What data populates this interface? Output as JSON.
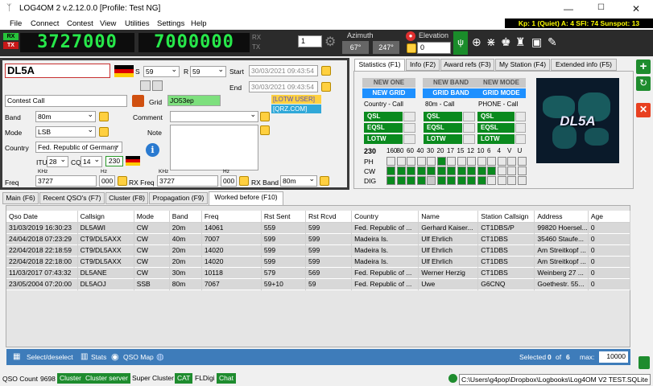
{
  "app": {
    "title": "LOG4OM 2 v.2.12.0.0 [Profile: Test NG]"
  },
  "menu": [
    "File",
    "Connect",
    "Contest",
    "View",
    "Utilities",
    "Settings",
    "Help"
  ],
  "solar": {
    "text": "Kp: 1 (Quiet)  A: 4  SFI: 74  Sunspot: 13"
  },
  "radio": {
    "rx": "RX",
    "tx": "TX",
    "freq1": "3727000",
    "freq2": "7000000",
    "rx_label": "RX",
    "tx_label": "TX",
    "vfo": "1",
    "azimuth_label": "Azimuth",
    "az1": "67°",
    "az2": "247°",
    "elevation_label": "Elevation",
    "elevation": "0"
  },
  "qso": {
    "callsign": "DL5A",
    "s_label": "S",
    "s": "59",
    "r_label": "R",
    "r": "59",
    "start_label": "Start",
    "start": "30/03/2021 09:43:54",
    "end_label": "End",
    "end": "30/03/2021 09:43:54",
    "contest_placeholder": "Contest Call",
    "grid_label": "Grid",
    "grid": "JO53ep",
    "band_label": "Band",
    "band": "80m",
    "comment_label": "Comment",
    "mode_label": "Mode",
    "mode": "LSB",
    "note_label": "Note",
    "country_label": "Country",
    "country": "Fed. Republic of Germany",
    "itu_label": "ITU",
    "itu": "28",
    "cq_label": "CQ",
    "cq": "14",
    "dxcc": "230",
    "freq_label": "Freq",
    "khz_label": "KHz",
    "hz_label": "Hz",
    "freq_khz": "3727",
    "freq_hz": "000",
    "rxfreq_label": "RX Freq",
    "rxfreq_khz": "3727",
    "rxfreq_hz": "000",
    "rxband_label": "RX Band",
    "rxband": "80m",
    "lotw": "[LOTW USER]",
    "qrz": "[QRZ.COM]"
  },
  "stats": {
    "tabs": [
      "Statistics (F1)",
      "Info (F2)",
      "Award refs (F3)",
      "My Station (F4)",
      "Extended info (F5)"
    ],
    "cols": [
      {
        "top": "NEW ONE",
        "bot": "NEW GRID",
        "sub": "Country - Call"
      },
      {
        "top": "NEW BAND",
        "bot": "GRID BAND",
        "sub": "80m - Call"
      },
      {
        "top": "NEW MODE",
        "bot": "GRID MODE",
        "sub": "PHONE - Call"
      }
    ],
    "conf": [
      "QSL",
      "EQSL",
      "LOTW"
    ],
    "dxcc": "230",
    "bands": [
      "160",
      "80",
      "60",
      "40",
      "30",
      "20",
      "17",
      "15",
      "12",
      "10",
      "6",
      "4",
      "V",
      "U"
    ],
    "rows": [
      "PH",
      "CW",
      "DIG"
    ],
    "call_image": "DL5A"
  },
  "tabs": [
    "Main (F6)",
    "Recent QSO's (F7)",
    "Cluster (F8)",
    "Propagation (F9)",
    "Worked before (F10)"
  ],
  "table": {
    "headers": [
      "Qso Date",
      "Callsign",
      "Mode",
      "Band",
      "Freq",
      "Rst Sent",
      "Rst Rcvd",
      "Country",
      "Name",
      "Station Callsign",
      "Address",
      "Age"
    ],
    "rows": [
      [
        "31/03/2019 16:30:23",
        "DL5AWI",
        "CW",
        "20m",
        "14061",
        "559",
        "599",
        "Fed. Republic of ...",
        "Gerhard Kaiser...",
        "CT1DBS/P",
        "99820 Hoersel...",
        "0"
      ],
      [
        "24/04/2018 07:23:29",
        "CT9/DL5AXX",
        "CW",
        "40m",
        "7007",
        "599",
        "599",
        "Madeira Is.",
        "Ulf Ehrlich",
        "CT1DBS",
        "35460 Staufe...",
        "0"
      ],
      [
        "22/04/2018 22:18:59",
        "CT9/DL5AXX",
        "CW",
        "20m",
        "14020",
        "599",
        "599",
        "Madeira Is.",
        "Ulf Ehrlich",
        "CT1DBS",
        "Am Streitkopf ...",
        "0"
      ],
      [
        "22/04/2018 22:18:00",
        "CT9/DL5AXX",
        "CW",
        "20m",
        "14020",
        "599",
        "599",
        "Madeira Is.",
        "Ulf Ehrlich",
        "CT1DBS",
        "Am Streitkopf ...",
        "0"
      ],
      [
        "11/03/2017 07:43:32",
        "DL5ANE",
        "CW",
        "30m",
        "10118",
        "579",
        "569",
        "Fed. Republic of ...",
        "Werner Herzig",
        "CT1DBS",
        "Weinberg 27 ...",
        "0"
      ],
      [
        "23/05/2004 07:20:00",
        "DL5AOJ",
        "SSB",
        "80m",
        "7067",
        "59+10",
        "59",
        "Fed. Republic of ...",
        "Uwe",
        "G6CNQ",
        "Goethestr. 55...",
        "0"
      ]
    ]
  },
  "bottom": {
    "select": "Select/deselect",
    "stats": "Stats",
    "map": "QSO Map",
    "selected_label": "Selected",
    "selected": "0",
    "of": "of",
    "total": "6",
    "max_label": "max:",
    "max": "10000"
  },
  "status": {
    "qso_count_label": "QSO Count",
    "qso_count": "9698",
    "cluster": "Cluster",
    "cluster_server": "Cluster server",
    "super_cluster": "Super Cluster",
    "cat": "CAT",
    "fldigi": "FLDigi",
    "chat": "Chat",
    "db": "C:\\Users\\g4pop\\Dropbox\\Logbooks\\Log4OM V2 TEST.SQLite"
  }
}
